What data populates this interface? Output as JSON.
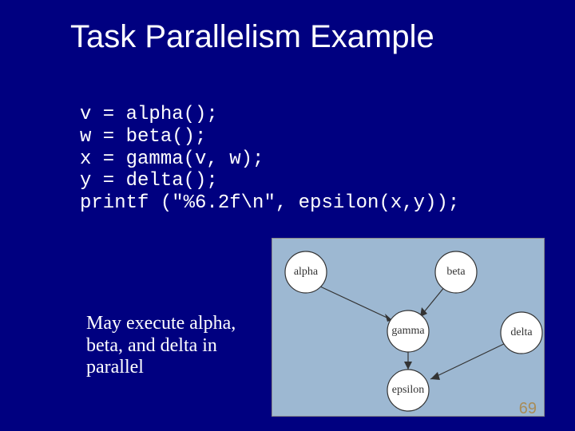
{
  "title": "Task Parallelism Example",
  "code": {
    "l1": "v = alpha();",
    "l2": "w = beta();",
    "l3": "x = gamma(v, w);",
    "l4": "y = delta();",
    "l5": "printf (\"%6.2f\\n\", epsilon(x,y));"
  },
  "caption": "May execute alpha, beta, and delta in parallel",
  "graph": {
    "nodes": {
      "alpha": "alpha",
      "beta": "beta",
      "delta": "delta",
      "gamma": "gamma",
      "epsilon": "epsilon"
    }
  },
  "page_number": "69"
}
